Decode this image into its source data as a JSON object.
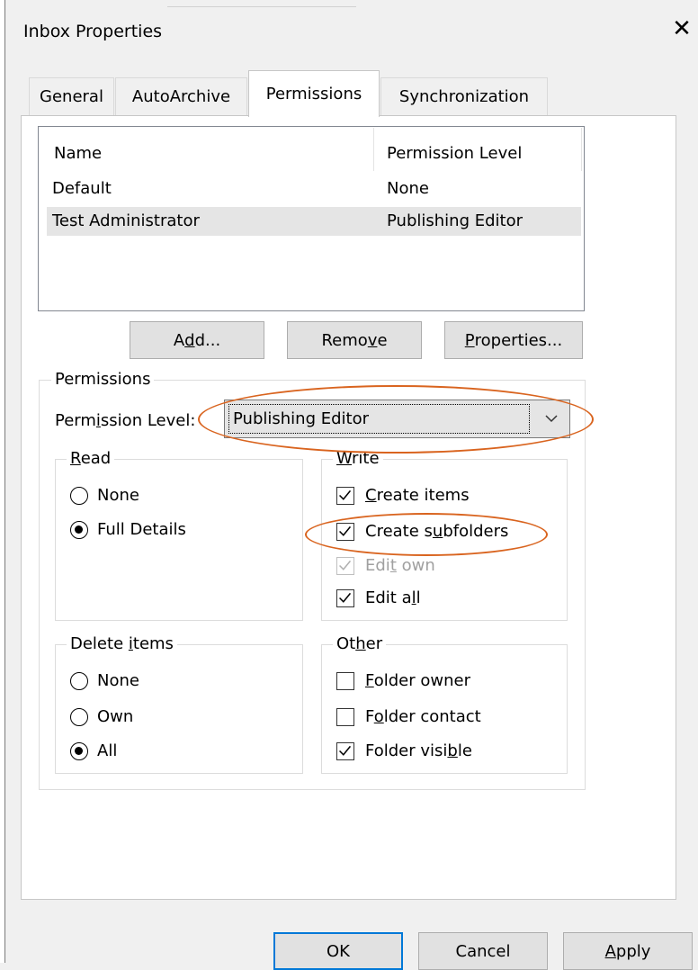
{
  "window": {
    "title": "Inbox Properties"
  },
  "tabs": [
    {
      "label": "General"
    },
    {
      "label": "AutoArchive"
    },
    {
      "label": "Permissions"
    },
    {
      "label": "Synchronization"
    }
  ],
  "list": {
    "headers": {
      "name": "Name",
      "level": "Permission Level"
    },
    "rows": [
      {
        "name": "Default",
        "level": "None"
      },
      {
        "name": "Test Administrator",
        "level": "Publishing Editor"
      }
    ]
  },
  "buttons": {
    "add": {
      "pre": "A",
      "u": "d",
      "post": "d..."
    },
    "remove": {
      "pre": "Remo",
      "u": "v",
      "post": "e"
    },
    "properties": {
      "pre": "",
      "u": "P",
      "post": "roperties..."
    }
  },
  "permissions": {
    "group_label": "Permissions",
    "level_label": {
      "pre": "Perm",
      "u": "i",
      "post": "ssion Level:"
    },
    "level_value": "Publishing Editor"
  },
  "read": {
    "label": {
      "pre": "",
      "u": "R",
      "post": "ead"
    },
    "options": [
      {
        "label": "None",
        "selected": false
      },
      {
        "label": "Full Details",
        "selected": true
      }
    ]
  },
  "write": {
    "label": {
      "pre": "",
      "u": "W",
      "post": "rite"
    },
    "options": [
      {
        "pre": "",
        "u": "C",
        "post": "reate items",
        "checked": true,
        "disabled": false
      },
      {
        "pre": "Create s",
        "u": "u",
        "post": "bfolders",
        "checked": true,
        "disabled": false
      },
      {
        "pre": "Edi",
        "u": "t",
        "post": " own",
        "checked": true,
        "disabled": true
      },
      {
        "pre": "Edit a",
        "u": "l",
        "post": "l",
        "checked": true,
        "disabled": false
      }
    ]
  },
  "delete": {
    "label": {
      "pre": "Delete ",
      "u": "i",
      "post": "tems"
    },
    "options": [
      {
        "label": "None",
        "selected": false
      },
      {
        "label": "Own",
        "selected": false
      },
      {
        "label": "All",
        "selected": true
      }
    ]
  },
  "other": {
    "label": {
      "pre": "Ot",
      "u": "h",
      "post": "er"
    },
    "options": [
      {
        "pre": "",
        "u": "F",
        "post": "older owner",
        "checked": false
      },
      {
        "pre": "F",
        "u": "o",
        "post": "lder contact",
        "checked": false
      },
      {
        "pre": "Folder visi",
        "u": "b",
        "post": "le",
        "checked": true
      }
    ]
  },
  "footer": {
    "ok": "OK",
    "cancel": "Cancel",
    "apply": {
      "pre": "",
      "u": "A",
      "post": "pply"
    }
  },
  "colors": {
    "annotation": "#d9641f",
    "focus": "#0078d7"
  }
}
